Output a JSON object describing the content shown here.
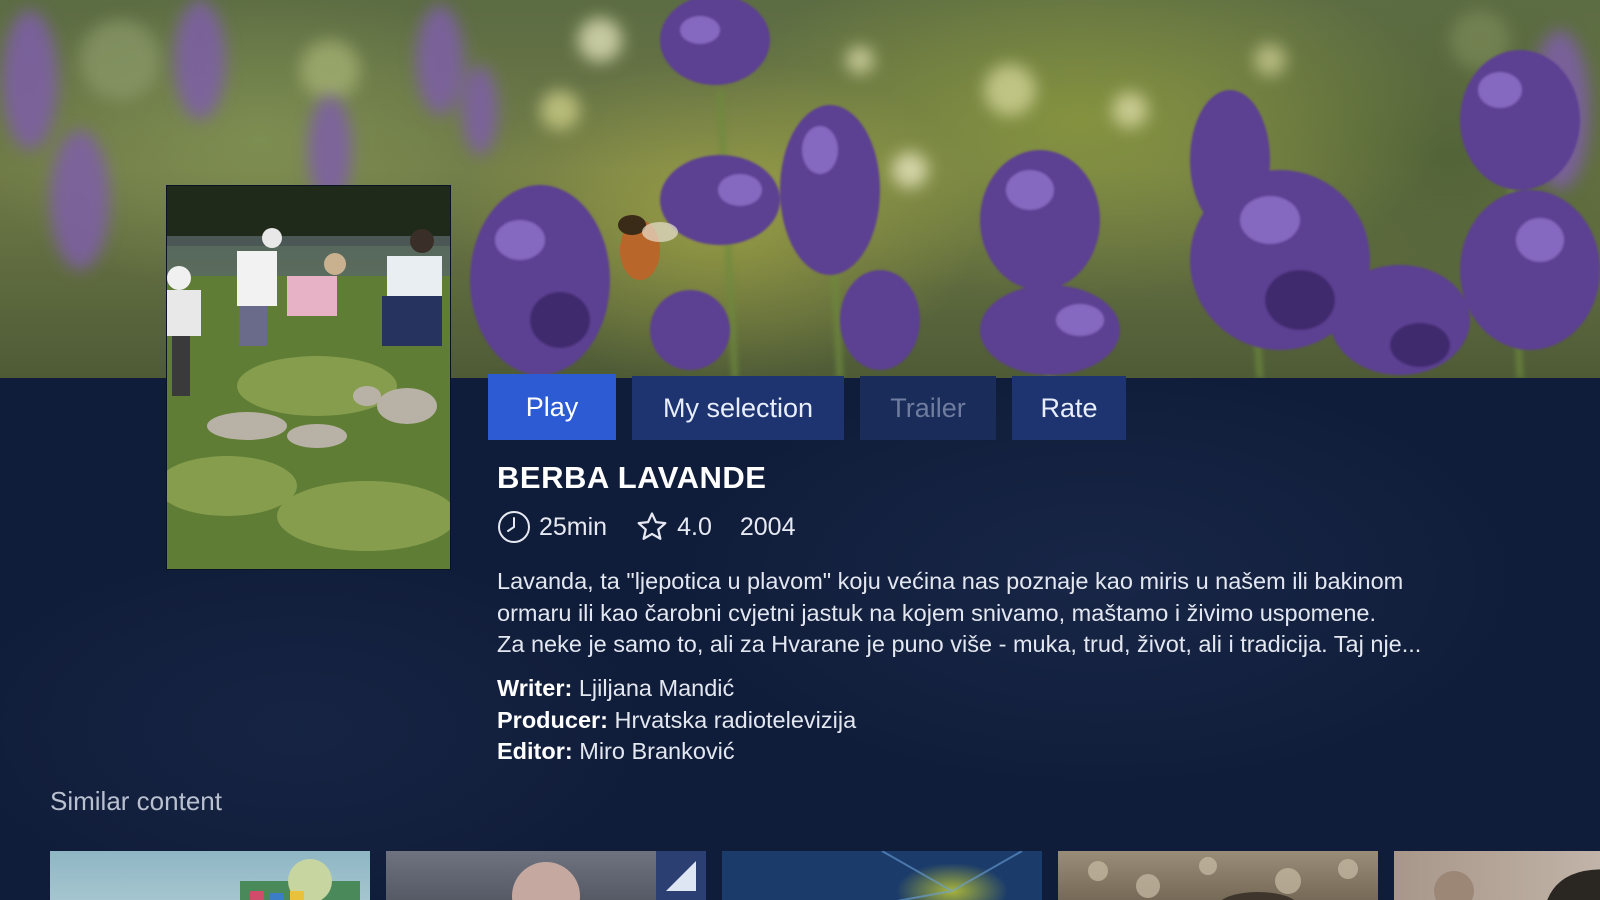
{
  "hero": {
    "image": "lavender-field-with-bee"
  },
  "poster": {
    "image": "people-harvesting-lavender"
  },
  "actions": {
    "play_label": "Play",
    "selection_label": "My selection",
    "trailer_label": "Trailer",
    "rate_label": "Rate"
  },
  "program": {
    "title": "BERBA LAVANDE",
    "duration": "25min",
    "rating": "4.0",
    "year": "2004",
    "description_lines": [
      "Lavanda, ta \"ljepotica u plavom\" koju većina nas poznaje kao miris u našem ili bakinom",
      "ormaru ili kao čarobni cvjetni jastuk na kojem snivamo, maštamo i živimo uspomene.",
      "Za neke je samo to, ali za Hvarane je puno više - muka, trud, život, ali i tradicija. Taj nje..."
    ],
    "credits": {
      "writer_label": "Writer:",
      "writer": "Ljiljana Mandić",
      "producer_label": "Producer:",
      "producer": "Hrvatska radiotelevizija",
      "editor_label": "Editor:",
      "editor": "Miro Branković"
    }
  },
  "similar": {
    "heading": "Similar content",
    "items": [
      "similar-thumb-1",
      "similar-thumb-2",
      "similar-thumb-3",
      "similar-thumb-4",
      "similar-thumb-5"
    ]
  },
  "colors": {
    "panel_bg": "#101d3a",
    "primary_button": "#2d5bd4",
    "secondary_button": "#1d3470",
    "disabled_button_text": "#6e7c9e"
  },
  "icons": {
    "duration": "clock-icon",
    "rating": "star-outline-icon"
  }
}
